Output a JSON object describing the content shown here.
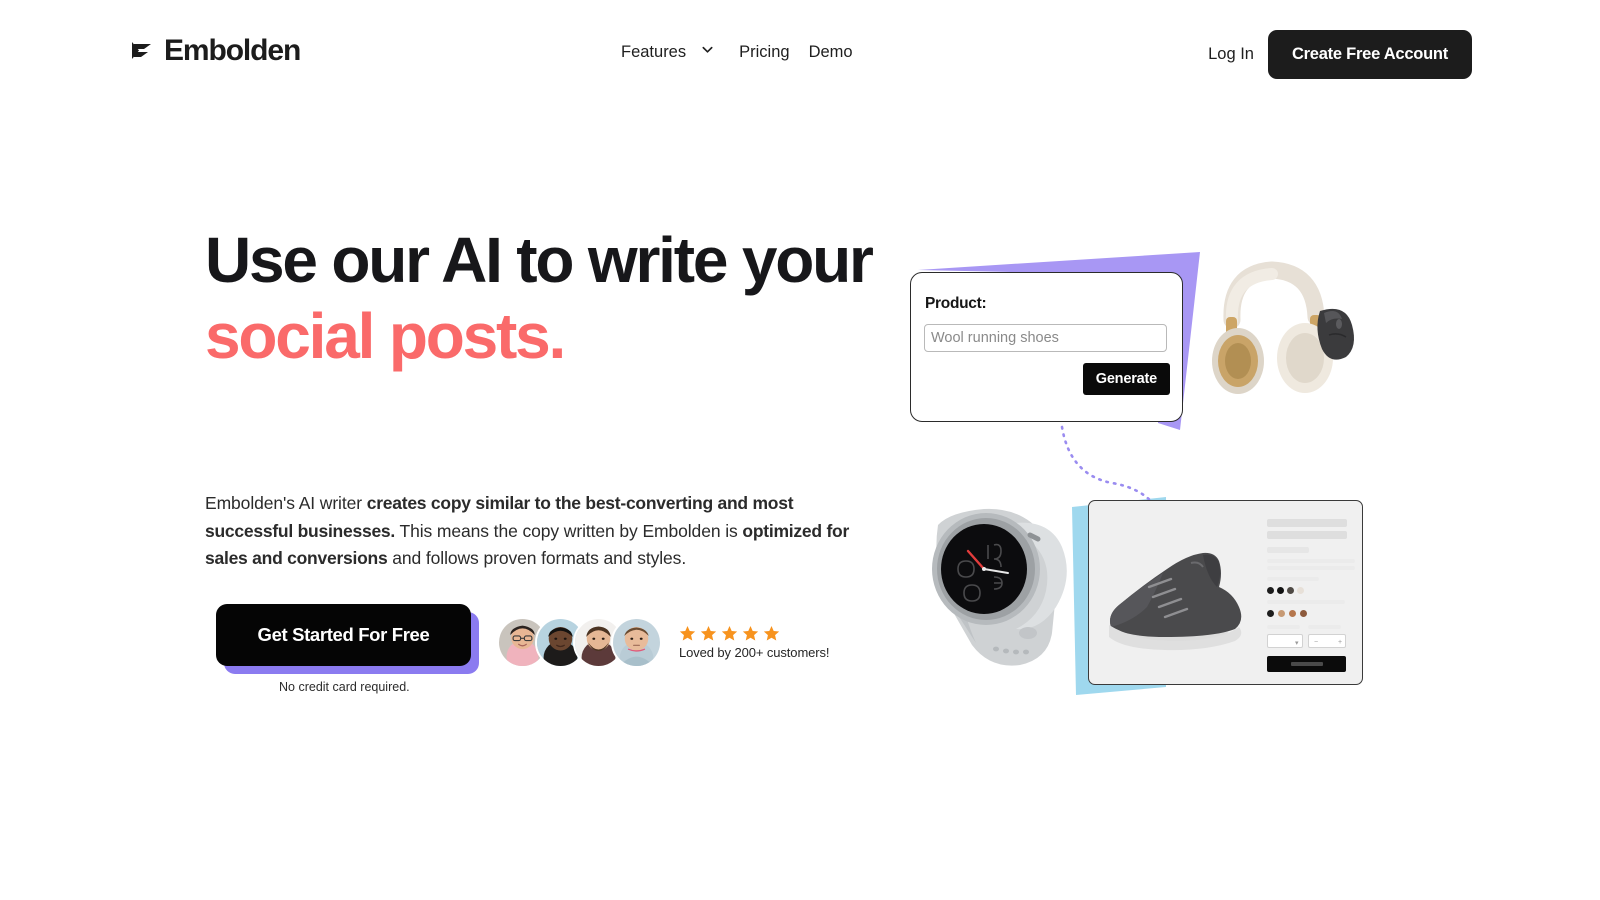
{
  "brand": {
    "name": "Embolden",
    "logo_icon": "embolden-arrow-icon"
  },
  "header": {
    "nav": [
      {
        "label": "Features",
        "icon": "chevron-down-icon"
      },
      {
        "label": "Pricing"
      },
      {
        "label": "Demo"
      }
    ],
    "login_label": "Log In",
    "cta_label": "Create Free Account"
  },
  "hero": {
    "headline_line1": "Use our AI to write",
    "headline_line2": "your",
    "headline_accent": "social posts.",
    "typing_cursor_icon": "typing-dashes-icon",
    "subcopy": {
      "part1": "Embolden's AI writer ",
      "bold1": "creates copy similar to the best-converting and most successful businesses.",
      "part2": " This means the copy written by Embolden is ",
      "bold2": "optimized for sales and conversions",
      "part3": " and follows proven formats and styles."
    },
    "cta_label": "Get Started For Free",
    "cta_note": "No credit card required.",
    "social_proof": {
      "rating_stars": 5,
      "star_icon": "star-icon",
      "caption": "Loved by 200+ customers!",
      "avatars": [
        {
          "name": "avatar-customer-1"
        },
        {
          "name": "avatar-customer-2"
        },
        {
          "name": "avatar-customer-3"
        },
        {
          "name": "avatar-customer-4"
        }
      ]
    }
  },
  "art": {
    "product_card": {
      "label": "Product:",
      "input_placeholder": "Wool running shoes",
      "input_value": "",
      "button_label": "Generate"
    },
    "items": [
      {
        "name": "headphones-image"
      },
      {
        "name": "mouse-image"
      },
      {
        "name": "smartwatch-image"
      },
      {
        "name": "running-shoe-image"
      }
    ],
    "connector": "dotted-curve-connector"
  },
  "colors": {
    "accent_purple": "#a897f4",
    "accent_blue": "#9fd8ee",
    "accent_coral": "#fa6a6a",
    "button_shadow_purple": "#8b7bf0",
    "dark": "#1c1c1c",
    "star_orange": "#f7931e"
  }
}
